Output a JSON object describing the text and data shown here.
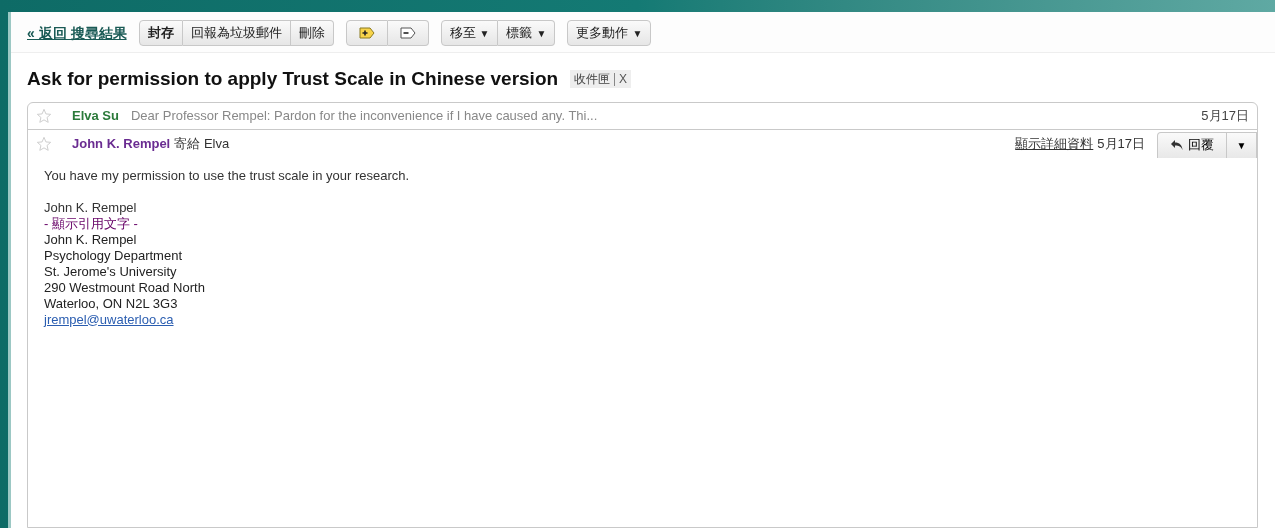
{
  "back_link": "« 返回 搜尋結果",
  "toolbar_groups": [
    [
      {
        "kind": "text",
        "label": "封存",
        "bold": true
      },
      {
        "kind": "text",
        "label": "回報為垃圾郵件",
        "bold": false
      },
      {
        "kind": "text",
        "label": "刪除",
        "bold": false
      }
    ],
    [
      {
        "kind": "add_label"
      },
      {
        "kind": "remove_label"
      }
    ],
    [
      {
        "kind": "menu",
        "label": "移至",
        "caret": "▼"
      },
      {
        "kind": "menu",
        "label": "標籤",
        "caret": "▼"
      }
    ],
    [
      {
        "kind": "menu",
        "label": "更多動作",
        "caret": "▼"
      }
    ]
  ],
  "subject": "Ask for permission to apply Trust Scale in Chinese version",
  "label_chip": {
    "label": "收件匣",
    "remove": "X"
  },
  "collapsed_message": {
    "starred": false,
    "sender": "Elva Su",
    "snippet": "Dear Professor Rempel: Pardon for the inconvenience if I have caused any. Thi...",
    "date": "5月17日"
  },
  "open_message": {
    "starred": false,
    "sender": "John K. Rempel",
    "to_label": "寄給",
    "recipient": "Elva",
    "details_link": "顯示詳細資料",
    "date": "5月17日",
    "reply_button": "回覆",
    "more_button": "▼",
    "body_first": "You have my permission to use the trust scale in your research.",
    "signature": "John K. Rempel",
    "quoted_toggle": "- 顯示引用文字 -",
    "quoted_lines": [
      "John K. Rempel",
      "Psychology Department",
      "St. Jerome's University",
      "290 Westmount Road North",
      "Waterloo, ON  N2L 3G3"
    ],
    "email_link": "jrempel@uwaterloo.ca"
  }
}
